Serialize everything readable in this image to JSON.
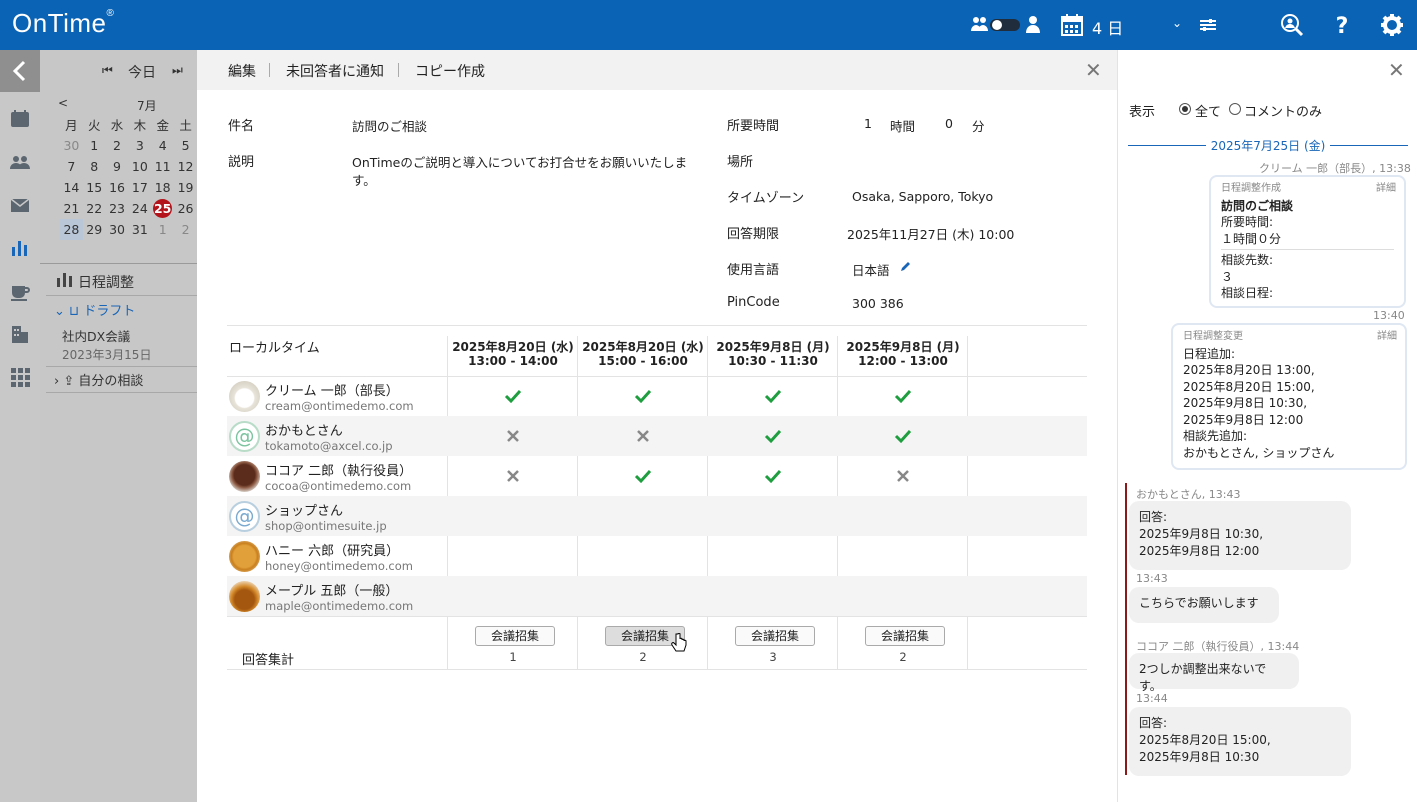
{
  "app": {
    "logo": "OnTime",
    "logo_mark": "®"
  },
  "topbar": {
    "view_label": "4 日"
  },
  "calendar": {
    "today_label": "今日",
    "month_label": "7月",
    "weekdays": [
      "月",
      "火",
      "水",
      "木",
      "金",
      "土"
    ],
    "weeks": [
      [
        "30",
        "1",
        "2",
        "3",
        "4",
        "5"
      ],
      [
        "7",
        "8",
        "9",
        "10",
        "11",
        "12"
      ],
      [
        "14",
        "15",
        "16",
        "17",
        "18",
        "19"
      ],
      [
        "21",
        "22",
        "23",
        "24",
        "25",
        "26"
      ],
      [
        "28",
        "29",
        "30",
        "31",
        "1",
        "2"
      ]
    ],
    "today": "25"
  },
  "left_panel": {
    "section_title": "日程調整",
    "draft_label": "ドラフト",
    "draft_item_title": "社内DX会議",
    "draft_item_date": "2023年3月15日",
    "mine_label": "自分の相談"
  },
  "toolbar": {
    "edit": "編集",
    "notify": "未回答者に通知",
    "copy": "コピー作成"
  },
  "details": {
    "subject_label": "件名",
    "subject": "訪問のご相談",
    "description_label": "説明",
    "description_line1": "OnTimeのご説明と導入についてお打合せをお願いいたしま",
    "description_line2": "す。",
    "duration_label": "所要時間",
    "duration_hours": "1",
    "hours_unit": "時間",
    "duration_minutes": "0",
    "minutes_unit": "分",
    "place_label": "場所",
    "timezone_label": "タイムゾーン",
    "timezone": "Osaka, Sapporo, Tokyo",
    "deadline_label": "回答期限",
    "deadline": "2025年11月27日 (木) 10:00",
    "language_label": "使用言語",
    "language": "日本語",
    "pincode_label": "PinCode",
    "pincode": "300 386"
  },
  "grid": {
    "local_time_label": "ローカルタイム",
    "columns": [
      {
        "date": "2025年8月20日 (水)",
        "time": "13:00 - 14:00",
        "button": "会議招集",
        "count": "1"
      },
      {
        "date": "2025年8月20日 (水)",
        "time": "15:00 - 16:00",
        "button": "会議招集",
        "count": "2"
      },
      {
        "date": "2025年9月8日 (月)",
        "time": "10:30 - 11:30",
        "button": "会議招集",
        "count": "3"
      },
      {
        "date": "2025年9月8日 (月)",
        "time": "12:00 - 13:00",
        "button": "会議招集",
        "count": "2"
      }
    ],
    "participants": [
      {
        "name": "クリーム 一郎（部長）",
        "email": "cream@ontimedemo.com",
        "answers": [
          "yes",
          "yes",
          "yes",
          "yes"
        ]
      },
      {
        "name": "おかもとさん",
        "email": "tokamoto@axcel.co.jp",
        "answers": [
          "no",
          "no",
          "yes",
          "yes"
        ]
      },
      {
        "name": "ココア 二郎（執行役員）",
        "email": "cocoa@ontimedemo.com",
        "answers": [
          "no",
          "yes",
          "yes",
          "no"
        ]
      },
      {
        "name": "ショップさん",
        "email": "shop@ontimesuite.jp",
        "answers": [
          "",
          "",
          "",
          ""
        ]
      },
      {
        "name": "ハニー 六郎（研究員）",
        "email": "honey@ontimedemo.com",
        "answers": [
          "",
          "",
          "",
          ""
        ]
      },
      {
        "name": "メープル 五郎（一般）",
        "email": "maple@ontimedemo.com",
        "answers": [
          "",
          "",
          "",
          ""
        ]
      }
    ],
    "summary_label": "回答集計"
  },
  "comments": {
    "show_label": "表示",
    "opt_all": "全て",
    "opt_comments": "コメントのみ",
    "date_divider": "2025年7月25日 (金)",
    "msg1_meta": "クリーム 一郎（部長）, 13:38",
    "msg1_caption": "日程調整作成",
    "detail_label": "詳細",
    "msg1_title": "訪問のご相談",
    "msg1_duration_label": "所要時間:",
    "msg1_duration": "１時間０分",
    "msg1_count_label": "相談先数:",
    "msg1_count": "３",
    "msg1_dates_label": "相談日程:",
    "msg2_time": "13:40",
    "msg2_caption": "日程調整変更",
    "msg2_add_label": "日程追加:",
    "msg2_dates": [
      "2025年8月20日 13:00,",
      "2025年8月20日 15:00,",
      "2025年9月8日 10:30,",
      "2025年9月8日 12:00"
    ],
    "msg2_person_label": "相談先追加:",
    "msg2_persons": "おかもとさん, ショップさん",
    "msg3_meta": "おかもとさん, 13:43",
    "msg3_label": "回答:",
    "msg3_lines": [
      "2025年9月8日 10:30,",
      "2025年9月8日 12:00"
    ],
    "msg4_time": "13:43",
    "msg4_text": "こちらでお願いします",
    "msg5_meta": "ココア 二郎（執行役員）, 13:44",
    "msg5_text": "2つしか調整出来ないです。",
    "msg6_time": "13:44",
    "msg6_label": "回答:",
    "msg6_lines": [
      "2025年8月20日 15:00,",
      "2025年9月8日 10:30"
    ]
  },
  "colors": {
    "brand": "#0a63b5",
    "accent": "#1966b8",
    "today": "#b3141b",
    "check": "#1e9e3e",
    "cross": "#888888"
  }
}
